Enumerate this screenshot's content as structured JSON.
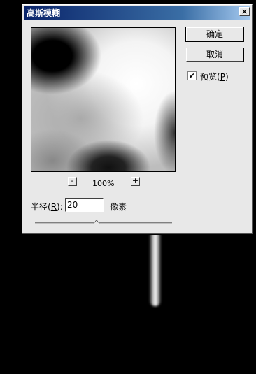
{
  "dialog": {
    "title": "高斯模糊",
    "close_label": "×"
  },
  "buttons": {
    "ok_label": "确定",
    "cancel_label": "取消"
  },
  "preview_checkbox": {
    "label": "预览(",
    "mnemonic": "P",
    "label_end": ")",
    "checked": true,
    "check_glyph": "✔"
  },
  "zoom": {
    "minus_label": "-",
    "plus_label": "+",
    "level": "100%"
  },
  "radius": {
    "label": "半径(",
    "mnemonic": "R",
    "label_end": "):",
    "value": "20",
    "unit": "像素"
  },
  "slider": {
    "fraction": 0.45
  },
  "colors": {
    "titlebar_start": "#0a246a",
    "dialog_bg": "#e8e8e8"
  }
}
